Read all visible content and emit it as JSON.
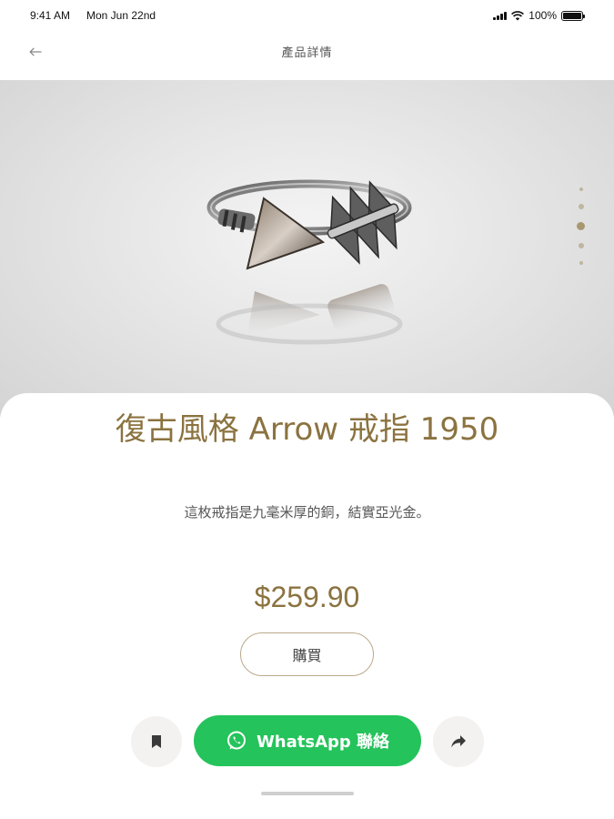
{
  "status_bar": {
    "time": "9:41 AM",
    "date": "Mon Jun 22nd",
    "battery": "100%"
  },
  "nav": {
    "back_icon": "arrow-left-icon",
    "title": "產品詳情"
  },
  "hero": {
    "image_subject": "silver-arrow-ring",
    "carousel_dots": 5,
    "active_dot": 3
  },
  "product": {
    "title": "復古風格 Arrow 戒指 1950",
    "description": "這枚戒指是九毫米厚的銅，結實亞光金。",
    "price": "$259.90",
    "buy_label": "購買"
  },
  "actions": {
    "bookmark_icon": "bookmark-icon",
    "whatsapp_icon": "whatsapp-icon",
    "whatsapp_label": "WhatsApp 聯絡",
    "share_icon": "share-arrow-icon"
  },
  "colors": {
    "accent_gold": "#8b7340",
    "whatsapp_green": "#25c35b",
    "dot_color": "#bfb6a0"
  }
}
